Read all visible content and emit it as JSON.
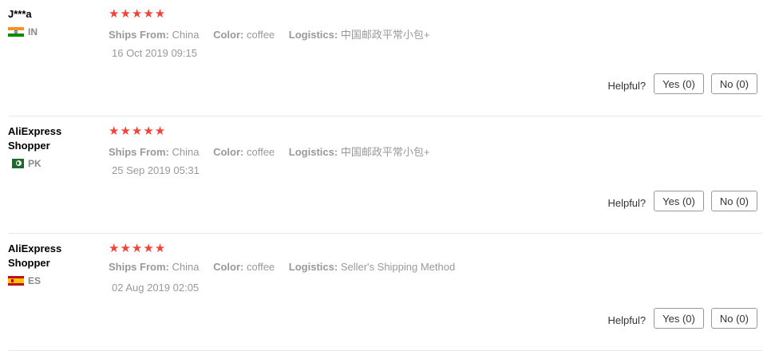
{
  "labels": {
    "ships_from": "Ships From:",
    "color": "Color:",
    "logistics": "Logistics:",
    "helpful": "Helpful?"
  },
  "rating_stars": "★★★★★",
  "reviews": [
    {
      "user": "J***a",
      "country_code": "IN",
      "flag": "india-flag-icon",
      "rating": 5,
      "ships_from": "China",
      "color": "coffee",
      "logistics": "中国邮政平常小包+",
      "date": "16 Oct 2019 09:15",
      "yes_label": "Yes (0)",
      "no_label": "No (0)"
    },
    {
      "user": "AliExpress Shopper",
      "country_code": "PK",
      "flag": "pakistan-flag-icon",
      "rating": 5,
      "ships_from": "China",
      "color": "coffee",
      "logistics": "中国邮政平常小包+",
      "date": "25 Sep 2019 05:31",
      "yes_label": "Yes (0)",
      "no_label": "No (0)"
    },
    {
      "user": "AliExpress Shopper",
      "country_code": "ES",
      "flag": "spain-flag-icon",
      "rating": 5,
      "ships_from": "China",
      "color": "coffee",
      "logistics": "Seller's Shipping Method",
      "date": "02 Aug 2019 02:05",
      "yes_label": "Yes (0)",
      "no_label": "No (0)"
    }
  ],
  "colors": {
    "star": "#f44336",
    "muted_text": "#999999",
    "divider": "#e8e8e8"
  }
}
